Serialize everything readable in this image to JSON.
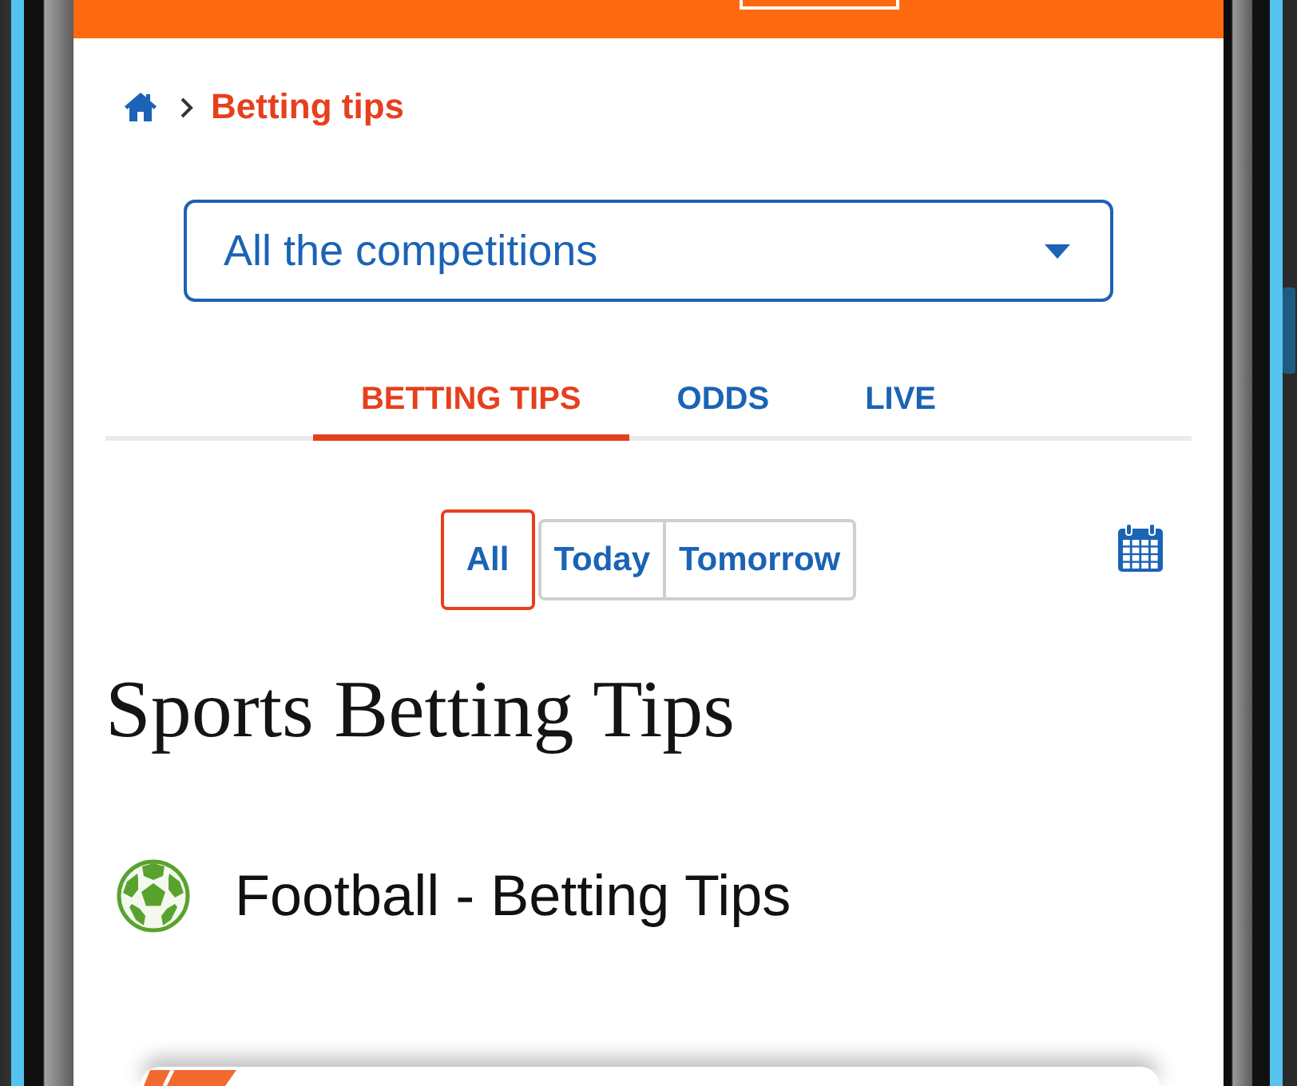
{
  "breadcrumb": {
    "current": "Betting tips"
  },
  "competition_select": {
    "value": "All the competitions"
  },
  "tabs": [
    {
      "label": "BETTING TIPS",
      "selected": true
    },
    {
      "label": "ODDS",
      "selected": false
    },
    {
      "label": "LIVE",
      "selected": false
    }
  ],
  "day_filter": [
    {
      "label": "All",
      "selected": true
    },
    {
      "label": "Today",
      "selected": false
    },
    {
      "label": "Tomorrow",
      "selected": false
    }
  ],
  "title": "Sports Betting Tips",
  "sport_section": {
    "title": "Football - Betting Tips"
  }
}
